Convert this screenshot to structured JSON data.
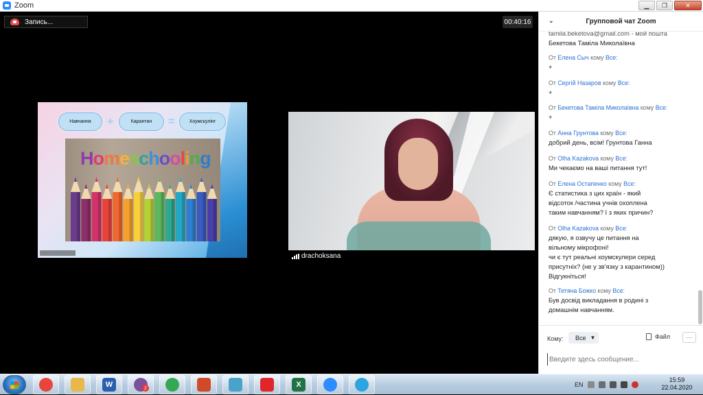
{
  "window": {
    "title": "Zoom",
    "minimize": "▁",
    "restore": "❐",
    "close": "✕"
  },
  "meeting": {
    "record_label": "Запись...",
    "timer": "00:40:16"
  },
  "slide": {
    "pill_left": "Навчання",
    "pill_mid": "Карантин",
    "pill_right": "Хоумскулінг",
    "op_plus": "+",
    "op_equals": "=",
    "hs_letters": [
      "H",
      "o",
      "m",
      "e",
      "s",
      "c",
      "h",
      "o",
      "o",
      "l",
      "i",
      "n",
      "g"
    ],
    "hs_colors": [
      "#8e3ca8",
      "#e23b6f",
      "#f0783c",
      "#f5b13d",
      "#8bc34a",
      "#26a69a",
      "#3f8fd8",
      "#6a4fc4",
      "#d84aa0",
      "#e8473f",
      "#f29b2f",
      "#4caf50",
      "#2f7dc9"
    ],
    "pencil_colors": [
      "#6b3b8c",
      "#8e2f6b",
      "#d2336a",
      "#e8423b",
      "#f0682f",
      "#f5a12e",
      "#f7d03c",
      "#b5d234",
      "#5cb85c",
      "#2ea88e",
      "#25a7c4",
      "#2f7fd1",
      "#3a5bbf",
      "#4a3fa8"
    ]
  },
  "participant": {
    "name": "drachoksana"
  },
  "chat": {
    "title": "Групповой чат Zoom",
    "messages": [
      {
        "partial_line": "tamila.beketova@gmail.com - мой пошта",
        "text": "Бекетова Таміла Миколаївна"
      },
      {
        "from": "От",
        "sender": "Елена Сыч",
        "to_word": "кому",
        "to": "Все:",
        "text": "+"
      },
      {
        "from": "От",
        "sender": "Сергій Назаров",
        "to_word": "кому",
        "to": "Все:",
        "text": "+"
      },
      {
        "from": "От",
        "sender": "Бекетова Таміла Миколаївна",
        "to_word": "кому",
        "to": "Все:",
        "text": "+"
      },
      {
        "from": "От",
        "sender": "Анна Грунтова",
        "to_word": "кому",
        "to": "Все:",
        "text": "добрий день, всім! Грунтова Ганна"
      },
      {
        "from": "От",
        "sender": "Olha Kazakova",
        "to_word": "кому",
        "to": "Все:",
        "text": "Ми чекаємо на ваші питання тут!"
      },
      {
        "from": "От",
        "sender": "Елена Остапенко",
        "to_word": "кому",
        "to": "Все:",
        "lines": [
          "Є статистика з цих країн - який",
          "відсоток /частина учнів охоплена",
          "таким навчанням? І з яких причин?"
        ]
      },
      {
        "from": "От",
        "sender": "Olha Kazakova",
        "to_word": "кому",
        "to": "Все:",
        "lines": [
          "дякую, я озвучу це питання на",
          "вільному мікрофоні!",
          "чи є тут реальні хоумскулери серед",
          "присутніх? (не у зв'язку з карантином))",
          "Відгукніться!"
        ]
      },
      {
        "from": "От",
        "sender": "Тетяна Божко",
        "to_word": "кому",
        "to": "Все:",
        "lines": [
          "Був досвід викладання в родині з",
          "домашнім навчанням."
        ]
      }
    ],
    "to_label": "Кому:",
    "to_value": "Все",
    "file_label": "Файл",
    "more_label": "···",
    "input_placeholder": "Введите здесь сообщение..."
  },
  "taskbar": {
    "apps": [
      {
        "name": "chrome",
        "color": "#e8453c"
      },
      {
        "name": "explorer",
        "color": "#e9b84a"
      },
      {
        "name": "word",
        "color": "#2b5fad",
        "glyph": "W"
      },
      {
        "name": "viber",
        "color": "#7b519d",
        "badge": "2"
      },
      {
        "name": "chrome-2",
        "color": "#34a853"
      },
      {
        "name": "powerpoint",
        "color": "#d04a2a"
      },
      {
        "name": "document",
        "color": "#4aa3c9"
      },
      {
        "name": "anydesk",
        "color": "#e0262b"
      },
      {
        "name": "excel",
        "color": "#217346",
        "glyph": "X"
      },
      {
        "name": "zoom",
        "color": "#2d8cff"
      },
      {
        "name": "telegram",
        "color": "#2ca5e0"
      }
    ],
    "lang": "EN",
    "time": "15:59",
    "date": "22.04.2020"
  }
}
